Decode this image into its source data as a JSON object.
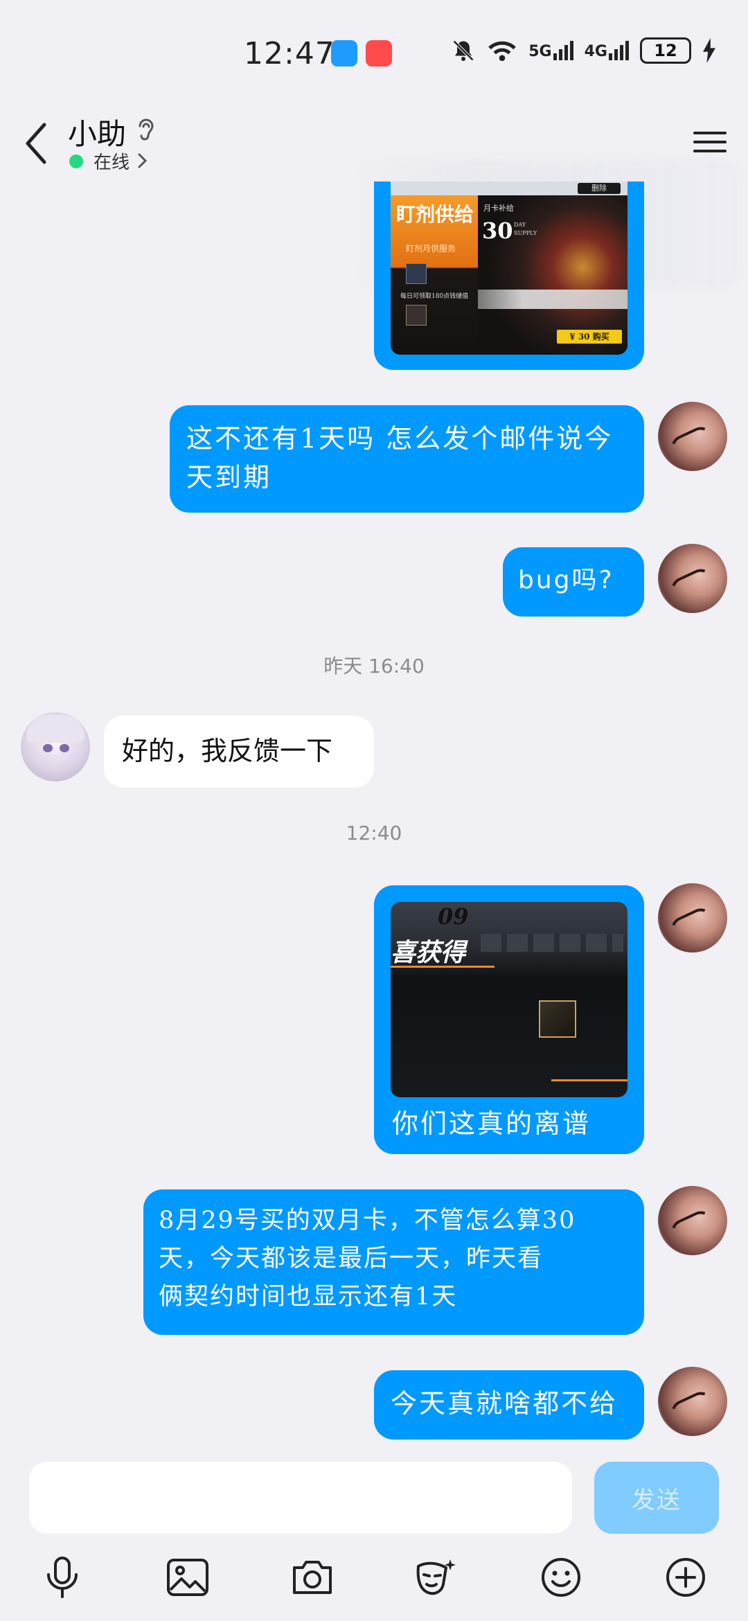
{
  "status_bar": {
    "time": "12:47",
    "network_1": "5G",
    "network_2": "4G",
    "battery": "12"
  },
  "header": {
    "contact_name": "小助",
    "online_status": "在线"
  },
  "messages": {
    "m1_text": "这不还有1天吗 怎么发个邮件说今天到期",
    "m1_line1": "这不还有1天吗 怎么发个邮件说今",
    "m1_line2": "天到期",
    "m2_text": "bug吗?",
    "ts1": "昨天 16:40",
    "m3_text": "好的，我反馈一下",
    "ts2": "12:40",
    "m4_caption": "你们这真的离谱",
    "m5_line1": "8月29号买的双月卡，不管怎么算30",
    "m5_line2": "天，今天都该是最后一天，昨天看",
    "m5_line3": "俩契约时间也显示还有1天",
    "m6_text": "今天真就啥都不给"
  },
  "image1": {
    "title": "盯剂供给",
    "subtitle": "盯剂月供服务",
    "item1": "每日可领取180点钱储值",
    "number": "30",
    "unit_top": "DAY",
    "unit_bottom": "SUPPLY",
    "month_label": "月卡补给",
    "price": "¥ 30 购买",
    "delete": "删除"
  },
  "image2": {
    "number": "09",
    "banner": "喜获得"
  },
  "input": {
    "placeholder": "",
    "send_label": "发送"
  },
  "colors": {
    "bubble_out": "#0099ff",
    "bubble_in": "#ffffff",
    "background": "#f0f0f5",
    "online_dot": "#26d980",
    "send_disabled": "#80cbff"
  }
}
